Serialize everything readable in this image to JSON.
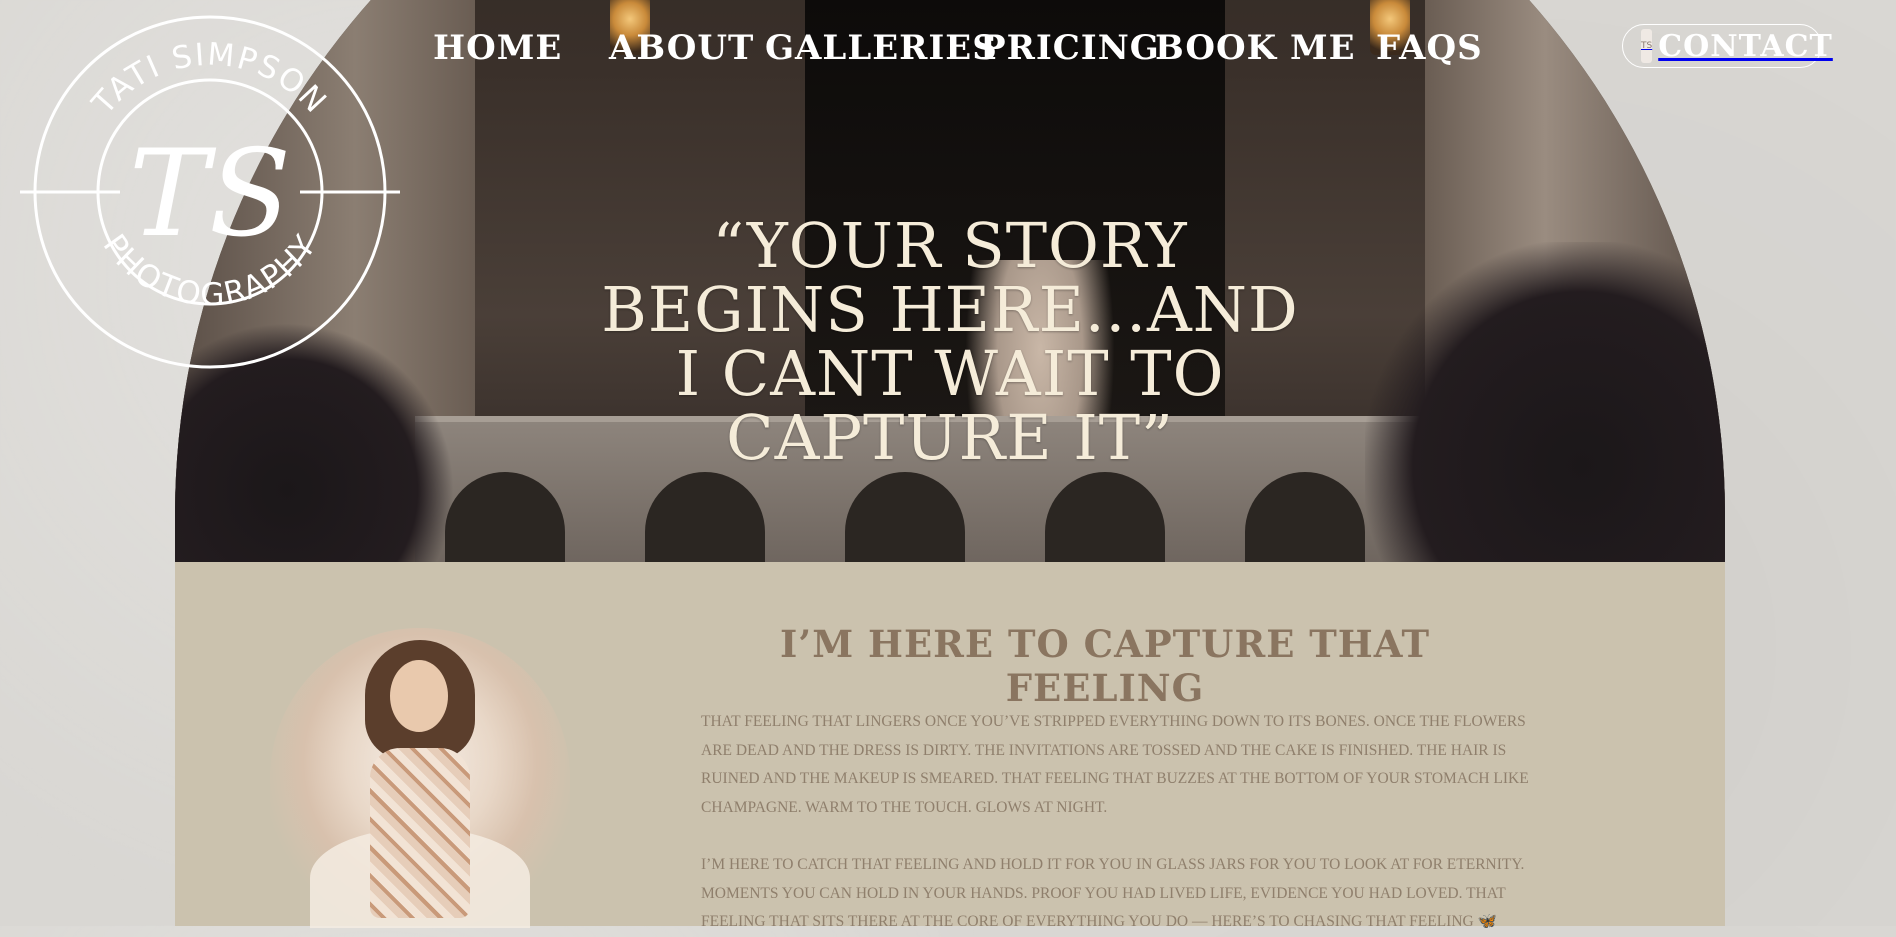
{
  "logo": {
    "monogram": "TS",
    "top_text": "TATI SIMPSON",
    "bottom_text": "PHOTOGRAPHY"
  },
  "nav": {
    "items": [
      {
        "label": "HOME"
      },
      {
        "label": "ABOUT"
      },
      {
        "label": "GALLERIES"
      },
      {
        "label": "PRICING"
      },
      {
        "label": "BOOK ME"
      },
      {
        "label": "FAQS"
      }
    ],
    "contact": {
      "badge": "TS",
      "label": "CONTACT"
    }
  },
  "hero": {
    "quote": "“YOUR STORY BEGINS HERE...AND I CANT WAIT TO CAPTURE IT”"
  },
  "intro": {
    "title": "I’M HERE TO CAPTURE THAT FEELING",
    "paragraphs": [
      "THAT FEELING THAT LINGERS ONCE YOU’VE STRIPPED EVERYTHING DOWN TO ITS BONES. ONCE THE FLOWERS ARE DEAD AND THE DRESS IS DIRTY. THE INVITATIONS ARE TOSSED AND THE CAKE IS FINISHED. THE HAIR IS RUINED AND THE MAKEUP IS SMEARED. THAT FEELING THAT BUZZES AT THE BOTTOM OF YOUR STOMACH LIKE CHAMPAGNE. WARM TO THE TOUCH. GLOWS AT NIGHT.",
      "I’M HERE TO CATCH THAT FEELING AND HOLD IT FOR YOU IN GLASS JARS FOR YOU TO LOOK AT FOR ETERNITY. MOMENTS YOU CAN HOLD IN YOUR HANDS. PROOF YOU HAD LIVED LIFE, EVIDENCE YOU HAD LOVED. THAT FEELING THAT SITS THERE AT THE CORE OF EVERYTHING YOU DO — HERE’S TO CHASING THAT FEELING 🦋"
    ]
  },
  "colors": {
    "page_bg": "#d9d7d3",
    "section_bg": "#cbc2ae",
    "title_color": "#8a7560",
    "body_text": "#8f7f6c",
    "quote_color": "#f5ecd9"
  }
}
